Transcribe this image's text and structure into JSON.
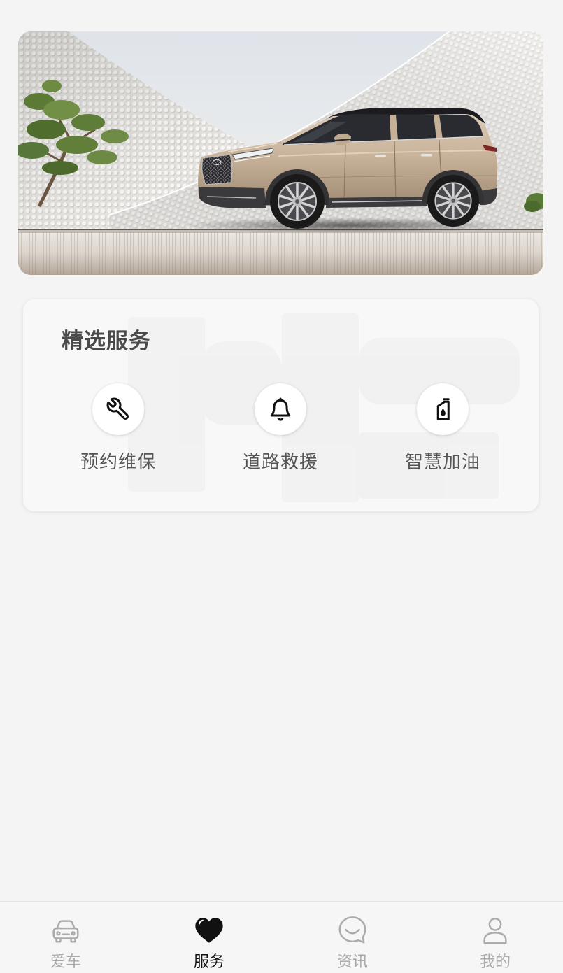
{
  "colors": {
    "page_bg": "#f4f4f4",
    "card_bg": "#f8f8f8",
    "title": "#4a4a4a",
    "label": "#555555",
    "icon": "#111111",
    "tab_active": "#111111",
    "tab_inactive": "#ababab",
    "tabbar_bg": "#f6f6f6"
  },
  "section": {
    "title": "精选服务"
  },
  "services": [
    {
      "label": "预约维保",
      "icon": "wrench-icon"
    },
    {
      "label": "道路救援",
      "icon": "bell-icon"
    },
    {
      "label": "智慧加油",
      "icon": "fuel-can-icon"
    }
  ],
  "tabbar": {
    "active_index": 1,
    "items": [
      {
        "label": "爱车",
        "icon": "car-icon"
      },
      {
        "label": "服务",
        "icon": "heart-icon"
      },
      {
        "label": "资讯",
        "icon": "chat-bubble-icon"
      },
      {
        "label": "我的",
        "icon": "user-icon"
      }
    ]
  }
}
